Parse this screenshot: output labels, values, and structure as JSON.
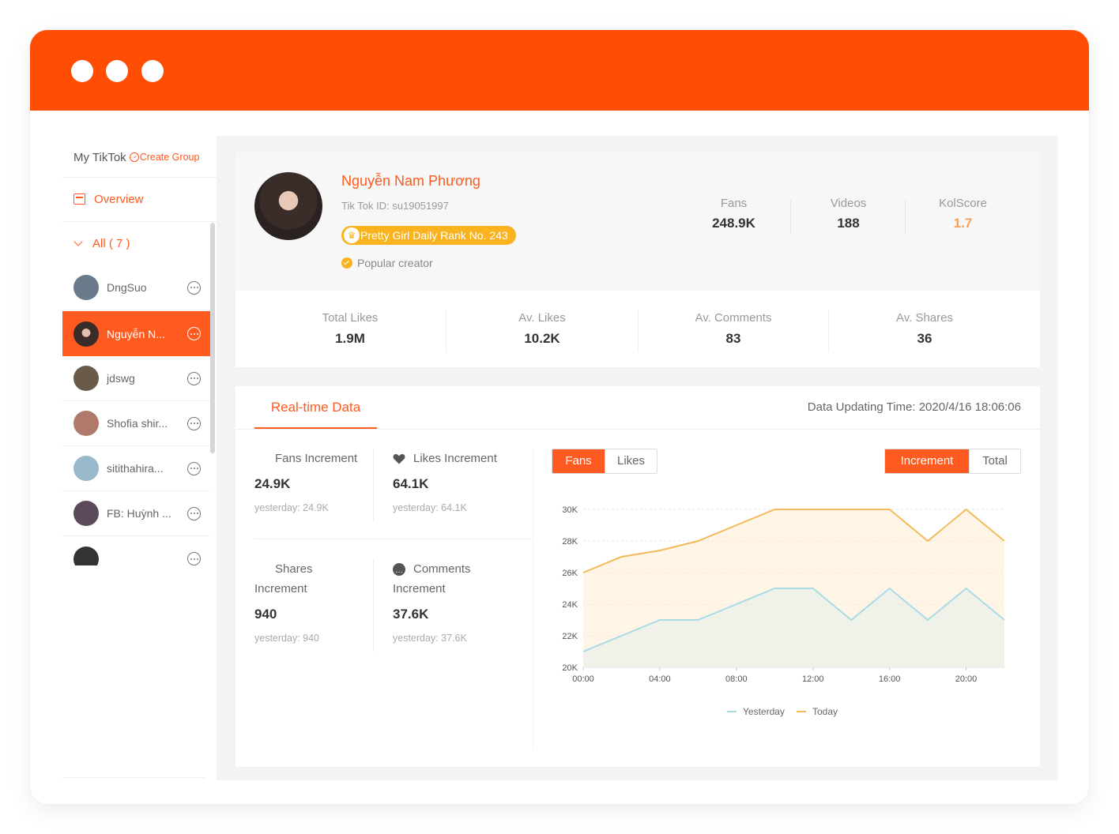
{
  "sidebar": {
    "header": "My TikTok",
    "create_group": "Create Group",
    "overview": "Overview",
    "all": "All ( 7 )",
    "accounts": [
      {
        "name": "DngSuo",
        "avatar": "#6b7a8a"
      },
      {
        "name": "Nguyễn N...",
        "avatar": "#4a3a34"
      },
      {
        "name": "jdswg",
        "avatar": "#6a5a4a"
      },
      {
        "name": "Shofia shir...",
        "avatar": "#b07a6a"
      },
      {
        "name": "sitithahira...",
        "avatar": "#9ab8cc"
      },
      {
        "name": "FB: Huỳnh ...",
        "avatar": "#5a4a5a"
      }
    ]
  },
  "profile": {
    "name": "Nguyễn Nam Phương",
    "tiktok_id": "Tik Tok ID: su19051997",
    "rank": "Pretty Girl Daily Rank No. 243",
    "badge": "Popular creator",
    "stats": [
      {
        "label": "Fans",
        "value": "248.9K"
      },
      {
        "label": "Videos",
        "value": "188"
      },
      {
        "label": "KolScore",
        "value": "1.7"
      }
    ]
  },
  "metrics": [
    {
      "label": "Total Likes",
      "value": "1.9M"
    },
    {
      "label": "Av. Likes",
      "value": "10.2K"
    },
    {
      "label": "Av. Comments",
      "value": "83"
    },
    {
      "label": "Av. Shares",
      "value": "36"
    }
  ],
  "realtime": {
    "tab": "Real-time Data",
    "updated": "Data Updating Time: 2020/4/16 18:06:06",
    "increments": [
      {
        "title_1": "Fans Increment",
        "title_2": "",
        "value": "24.9K",
        "yesterday": "yesterday: 24.9K"
      },
      {
        "title_1": "Likes Increment",
        "title_2": "",
        "value": "64.1K",
        "yesterday": "yesterday: 64.1K"
      },
      {
        "title_1": "Shares",
        "title_2": "Increment",
        "value": "940",
        "yesterday": "yesterday: 940"
      },
      {
        "title_1": "Comments",
        "title_2": "Increment",
        "value": "37.6K",
        "yesterday": "yesterday: 37.6K"
      }
    ],
    "metric_toggle": [
      "Fans",
      "Likes"
    ],
    "mode_toggle": [
      "Increment",
      "Total"
    ]
  },
  "colors": {
    "brand": "#ff4d04",
    "accent": "#ff5a1f",
    "rank_badge": "#f8b31f",
    "today_line": "#f5b95a",
    "yesterday_line": "#a8dbe6"
  },
  "chart_data": {
    "type": "area",
    "x": [
      "00:00",
      "02:00",
      "04:00",
      "06:00",
      "08:00",
      "10:00",
      "12:00",
      "14:00",
      "16:00",
      "18:00",
      "20:00",
      "22:00"
    ],
    "x_ticks": [
      "00:00",
      "04:00",
      "08:00",
      "12:00",
      "16:00",
      "20:00"
    ],
    "y_ticks": [
      "20K",
      "22K",
      "24K",
      "26K",
      "28K",
      "30K"
    ],
    "ylim": [
      20000,
      30000
    ],
    "grid": true,
    "legend": "bottom-center",
    "series": [
      {
        "name": "Yesterday",
        "color": "#a8dbe6",
        "values": [
          21000,
          22000,
          23000,
          23000,
          24000,
          25000,
          25000,
          23000,
          25000,
          23000,
          25000,
          23000
        ]
      },
      {
        "name": "Today",
        "color": "#f5b95a",
        "values": [
          26000,
          27000,
          27400,
          28000,
          29000,
          30000,
          30000,
          30000,
          30000,
          28000,
          30000,
          28000
        ]
      }
    ]
  }
}
